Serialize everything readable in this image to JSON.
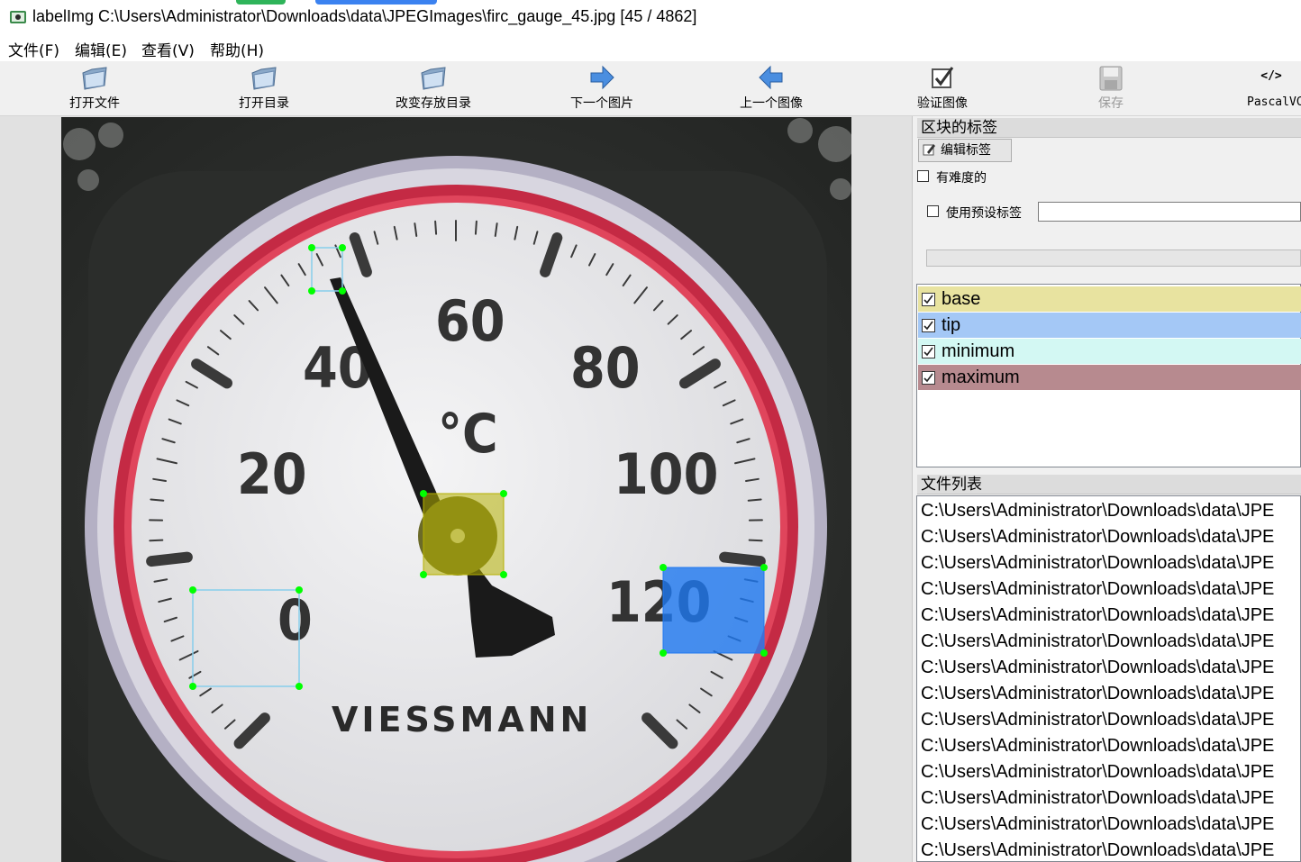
{
  "window": {
    "app_name": "labelImg",
    "title": "labelImg C:\\Users\\Administrator\\Downloads\\data\\JPEGImages\\firc_gauge_45.jpg [45 / 4862]"
  },
  "menu": [
    "文件(F)",
    "编辑(E)",
    "查看(V)",
    "帮助(H)"
  ],
  "toolbar": {
    "open_file": "打开文件",
    "open_dir": "打开目录",
    "change_save_dir": "改变存放目录",
    "next_image": "下一个图片",
    "prev_image": "上一个图像",
    "verify_image": "验证图像",
    "save": "保存",
    "format": "PascalVC",
    "format_icon_text": "</>"
  },
  "label_panel": {
    "header": "区块的标签",
    "edit_label_button": "编辑标签",
    "difficult_label": "有难度的",
    "use_default_label": "使用预设标签",
    "default_label_value": "",
    "labels": [
      {
        "name": "base",
        "checked": true,
        "color": "#e8e3a0"
      },
      {
        "name": "tip",
        "checked": true,
        "color": "#a4c8f6"
      },
      {
        "name": "minimum",
        "checked": true,
        "color": "#d3f8f3"
      },
      {
        "name": "maximum",
        "checked": true,
        "color": "#b78a8f"
      }
    ]
  },
  "file_panel": {
    "header": "文件列表",
    "files": [
      "C:\\Users\\Administrator\\Downloads\\data\\JPE",
      "C:\\Users\\Administrator\\Downloads\\data\\JPE",
      "C:\\Users\\Administrator\\Downloads\\data\\JPE",
      "C:\\Users\\Administrator\\Downloads\\data\\JPE",
      "C:\\Users\\Administrator\\Downloads\\data\\JPE",
      "C:\\Users\\Administrator\\Downloads\\data\\JPE",
      "C:\\Users\\Administrator\\Downloads\\data\\JPE",
      "C:\\Users\\Administrator\\Downloads\\data\\JPE",
      "C:\\Users\\Administrator\\Downloads\\data\\JPE",
      "C:\\Users\\Administrator\\Downloads\\data\\JPE",
      "C:\\Users\\Administrator\\Downloads\\data\\JPE",
      "C:\\Users\\Administrator\\Downloads\\data\\JPE",
      "C:\\Users\\Administrator\\Downloads\\data\\JPE",
      "C:\\Users\\Administrator\\Downloads\\data\\JPE"
    ]
  },
  "gauge": {
    "dial_numbers": [
      "0",
      "20",
      "40",
      "60",
      "80",
      "100",
      "120"
    ],
    "unit": "°C",
    "brand": "VIESSMANN"
  },
  "colors": {
    "annotation_base": "#b5b100",
    "annotation_tip": "#87ceeb",
    "annotation_minimum": "#87ceeb",
    "annotation_maximum": "#1e78f0",
    "handle": "#00ff00"
  }
}
